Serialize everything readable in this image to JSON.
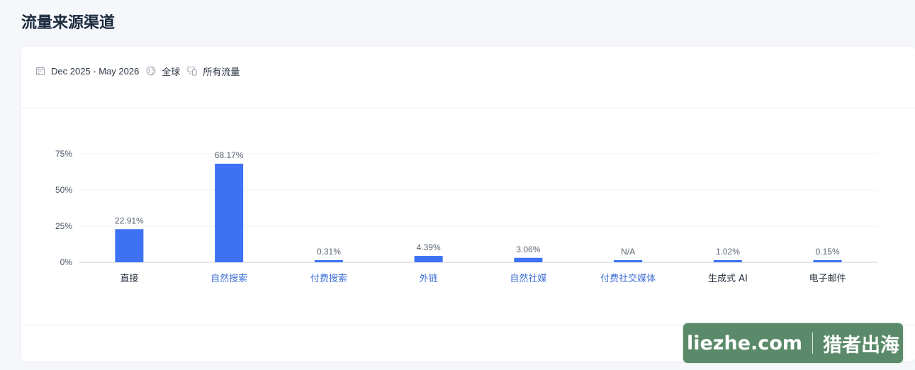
{
  "page": {
    "title": "流量来源渠道"
  },
  "filters": {
    "date_range": "Dec 2025 - May 2026",
    "region": "全球",
    "traffic_type": "所有流量"
  },
  "watermark": {
    "site": "liezhe.com",
    "brand": "猎者出海"
  },
  "colors": {
    "bar": "#3d72f5",
    "link_label": "#3d6fd6",
    "plain_label": "#2b3543"
  },
  "chart_data": {
    "type": "bar",
    "categories": [
      "直接",
      "自然搜索",
      "付费搜索",
      "外链",
      "自然社媒",
      "付费社交媒体",
      "生成式 AI",
      "电子邮件"
    ],
    "values": [
      22.91,
      68.17,
      0.31,
      4.39,
      3.06,
      0,
      1.02,
      0.15
    ],
    "data_labels": [
      "22.91%",
      "68.17%",
      "0.31%",
      "4.39%",
      "3.06%",
      "N/A",
      "1.02%",
      "0.15%"
    ],
    "category_links": [
      false,
      true,
      true,
      true,
      true,
      true,
      false,
      false
    ],
    "yticks": [
      0,
      25,
      50,
      75
    ],
    "ytick_labels": [
      "0%",
      "25%",
      "50%",
      "75%"
    ],
    "ylim": [
      0,
      75
    ],
    "grid": true,
    "title": "",
    "xlabel": "",
    "ylabel": ""
  }
}
